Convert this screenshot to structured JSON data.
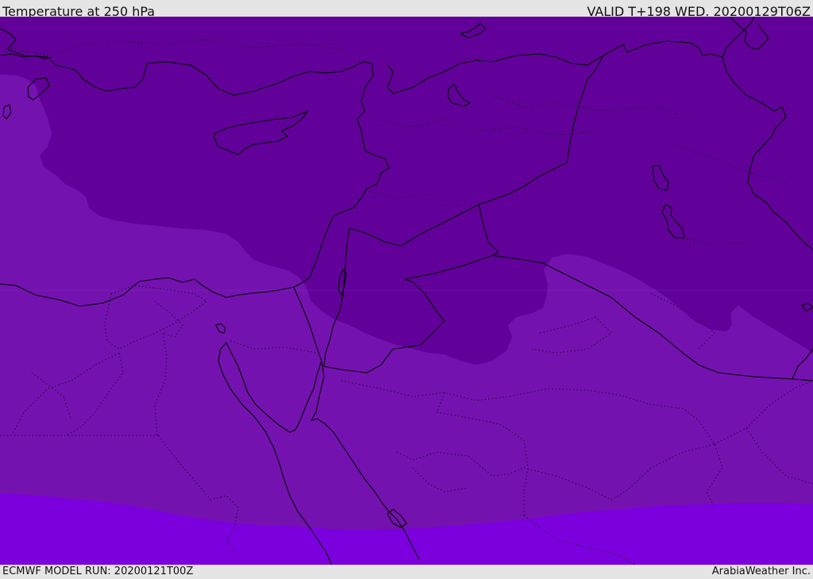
{
  "header": {
    "title": "Temperature at 250 hPa",
    "valid": "VALID T+198 WED. 20200129T06Z"
  },
  "footer": {
    "model_run": "ECMWF MODEL RUN: 20200121T00Z",
    "credit": "ArabiaWeather Inc."
  },
  "colors": {
    "band_coldest": "#62009a",
    "band_middle": "#7412b0",
    "band_warmest": "#7c00de",
    "coastline": "#000000",
    "border_dotted": "#1a0830",
    "header_bg": "#e5e5e5"
  }
}
